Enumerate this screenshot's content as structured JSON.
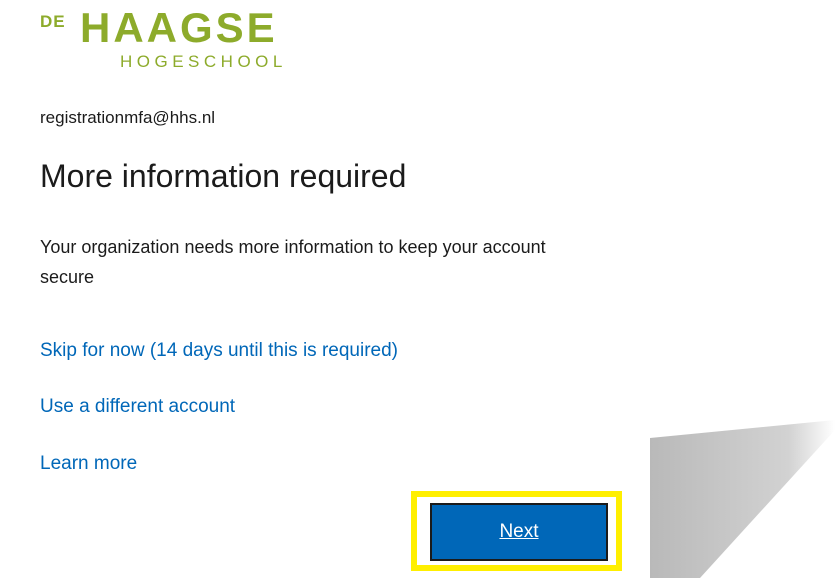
{
  "logo": {
    "prefix": "DE",
    "main": "HAAGSE",
    "sub": "HOGESCHOOL",
    "brand_color": "#8dab2b"
  },
  "account": {
    "email": "registrationmfa@hhs.nl"
  },
  "page": {
    "title": "More information required",
    "description": "Your organization needs more information to keep your account secure"
  },
  "links": {
    "skip": "Skip for now (14 days until this is required)",
    "different_account": "Use a different account",
    "learn_more": "Learn more"
  },
  "actions": {
    "next_label": "Next"
  },
  "colors": {
    "link": "#0067b8",
    "button": "#0067b8",
    "highlight": "#ffef00",
    "text": "#1b1b1b"
  }
}
